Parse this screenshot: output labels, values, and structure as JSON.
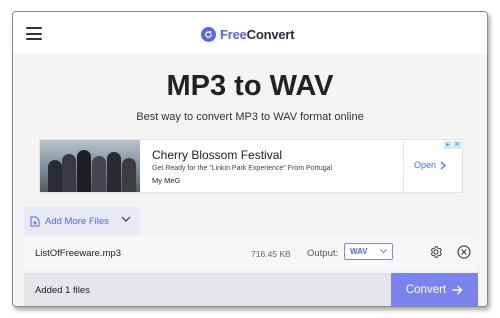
{
  "header": {
    "logo_part1": "Free",
    "logo_part2": "Convert",
    "menu_icon": "hamburger-icon",
    "logo_icon": "refresh-circle-icon"
  },
  "main": {
    "title": "MP3 to WAV",
    "subtitle": "Best way to convert MP3 to WAV format online"
  },
  "ad": {
    "headline": "Cherry Blossom Festival",
    "description": "Get Ready for the \"Linkin Park Experience\" From Portugal",
    "brand": "My MeG",
    "open_label": "Open"
  },
  "uploader": {
    "add_more_label": "Add More Files"
  },
  "file": {
    "name": "ListOfFreeware.mp3",
    "size": "716.45 KB",
    "output_label": "Output:",
    "output_value": "WAV"
  },
  "footer": {
    "status": "Added 1 files",
    "convert_label": "Convert"
  },
  "colors": {
    "accent": "#5a66e8",
    "convert_button": "#7b84ee",
    "page_bg": "#f4f4f4"
  }
}
